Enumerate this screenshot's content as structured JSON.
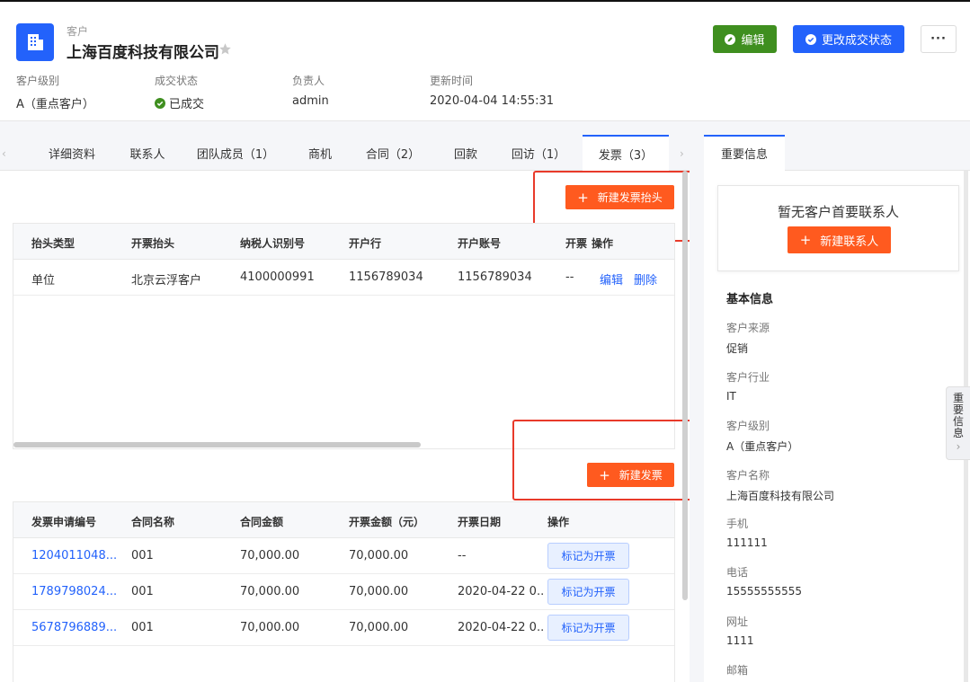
{
  "header": {
    "breadcrumb": "客户",
    "title": "上海百度科技有限公司",
    "edit_label": "编辑",
    "status_label": "更改成交状态",
    "more_label": "···",
    "meta": [
      {
        "label": "客户级别",
        "value": "A（重点客户）"
      },
      {
        "label": "成交状态",
        "value": "已成交"
      },
      {
        "label": "负责人",
        "value": "admin"
      },
      {
        "label": "更新时间",
        "value": "2020-04-04 14:55:31"
      }
    ]
  },
  "tabs": [
    "详细资料",
    "联系人",
    "团队成员（1）",
    "商机",
    "合同（2）",
    "回款",
    "回访（1）",
    "发票（3）"
  ],
  "invoice_title": {
    "add_label": "新建发票抬头",
    "columns": [
      "抬头类型",
      "开票抬头",
      "纳税人识别号",
      "开户行",
      "开户账号",
      "开票",
      "操作"
    ],
    "rows": [
      {
        "type": "单位",
        "title": "北京云浮客户",
        "tax_id": "4100000991",
        "bank": "1156789034",
        "account": "1156789034",
        "extra": "--",
        "edit": "编辑",
        "delete": "删除"
      }
    ]
  },
  "invoices": {
    "add_label": "新建发票",
    "columns": [
      "发票申请编号",
      "合同名称",
      "合同金额",
      "开票金额（元）",
      "开票日期",
      "操作"
    ],
    "mark_label": "标记为开票",
    "rows": [
      {
        "no": "1204011048...",
        "contract": "001",
        "amount": "70,000.00",
        "invoice_amount": "70,000.00",
        "date": "--"
      },
      {
        "no": "1789798024...",
        "contract": "001",
        "amount": "70,000.00",
        "invoice_amount": "70,000.00",
        "date": "2020-04-22 0..."
      },
      {
        "no": "5678796889...",
        "contract": "001",
        "amount": "70,000.00",
        "invoice_amount": "70,000.00",
        "date": "2020-04-22 0..."
      }
    ]
  },
  "right": {
    "tab": "重要信息",
    "empty_contact": "暂无客户首要联系人",
    "add_contact": "新建联系人",
    "section": "基本信息",
    "fields": [
      {
        "label": "客户来源",
        "value": "促销"
      },
      {
        "label": "客户行业",
        "value": "IT"
      },
      {
        "label": "客户级别",
        "value": "A（重点客户）"
      },
      {
        "label": "客户名称",
        "value": "上海百度科技有限公司"
      },
      {
        "label": "手机",
        "value": "111111"
      },
      {
        "label": "电话",
        "value": "15555555555"
      },
      {
        "label": "网址",
        "value": "1111"
      },
      {
        "label": "邮箱",
        "value": ""
      }
    ],
    "side_tab": "重要信息"
  },
  "colors": {
    "primary": "#2362fb",
    "success": "#3f8f1f",
    "orange": "#ff5a1f",
    "highlight": "#e83a2a"
  }
}
